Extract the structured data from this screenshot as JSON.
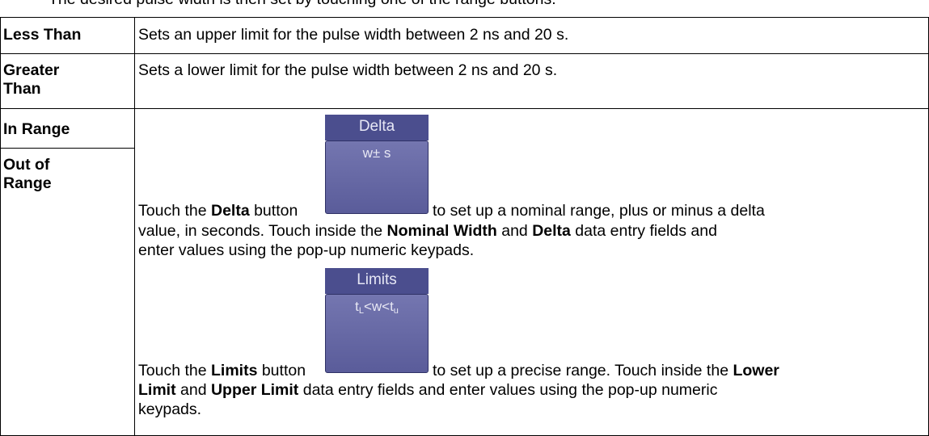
{
  "top_line": "The desired pulse width is then set by touching one of the range buttons:",
  "rows": {
    "less_than": {
      "term": "Less Than",
      "desc": "Sets an upper limit for the pulse width between 2 ns and 20 s."
    },
    "greater_than": {
      "term_line1": "Greater",
      "term_line2": "Than",
      "desc": "Sets a lower limit for the pulse width between 2 ns and 20 s."
    },
    "in_range": {
      "term": "In Range"
    },
    "out_of_range": {
      "term_line1": "Out of",
      "term_line2": "Range"
    }
  },
  "delta": {
    "button_caption": "Delta",
    "button_glyph": "w± s",
    "p1_start": "Touch the ",
    "p1_bold1": "Delta",
    "p1_mid": " button",
    "p1_after_button": "to set up a nominal range, plus or minus a delta",
    "p1_line2_start": "value, in seconds. Touch inside the ",
    "p1_bold2": "Nominal Width",
    "p1_and": " and ",
    "p1_bold3": "Delta",
    "p1_line2_end": " data entry fields and",
    "p1_line3": "enter values using the pop-up numeric keypads."
  },
  "limits": {
    "button_caption": "Limits",
    "glyph_t": "t",
    "glyph_l": "L",
    "glyph_mid": "<w<t",
    "glyph_u": "u",
    "p2_start": "Touch the ",
    "p2_bold1": "Limits",
    "p2_mid": " button",
    "p2_after_button": "to set up a precise range. Touch inside the ",
    "p2_bold2": "Lower",
    "p2_line2_bold": "Limit",
    "p2_line2_and": " and ",
    "p2_line2_bold2": "Upper Limit",
    "p2_line2_end": " data entry fields and enter values using the pop-up numeric",
    "p2_line3": "keypads."
  }
}
